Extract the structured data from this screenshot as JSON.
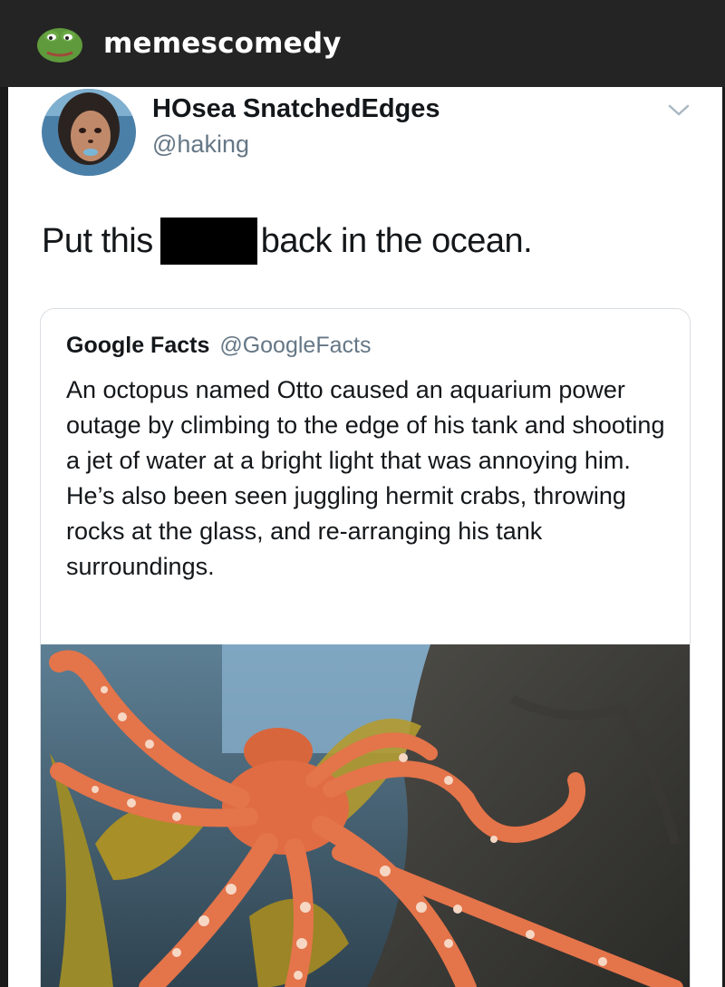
{
  "header": {
    "channel_name": "memescomedy",
    "channel_icon": "pepe-frog-avatar",
    "bar_color": "#242424"
  },
  "tweet": {
    "display_name": "HOsea SnatchedEdges",
    "handle": "@haking",
    "text_before": "Put this",
    "text_after": "back in the ocean.",
    "menu_icon": "chevron-down-icon"
  },
  "quoted_tweet": {
    "display_name": "Google Facts",
    "handle": "@GoogleFacts",
    "text": "An octopus named Otto caused an aquarium power outage by climbing to the edge of his tank and shooting a jet of water at a bright light that was annoying him. He’s also been seen juggling hermit crabs, throwing rocks at the glass, and re-arranging his tank surroundings.",
    "image": "octopus-photo"
  },
  "colors": {
    "name_text": "#14171a",
    "secondary_text": "#657786",
    "card_border": "#d9dde1",
    "octopus": "#e36f45"
  }
}
